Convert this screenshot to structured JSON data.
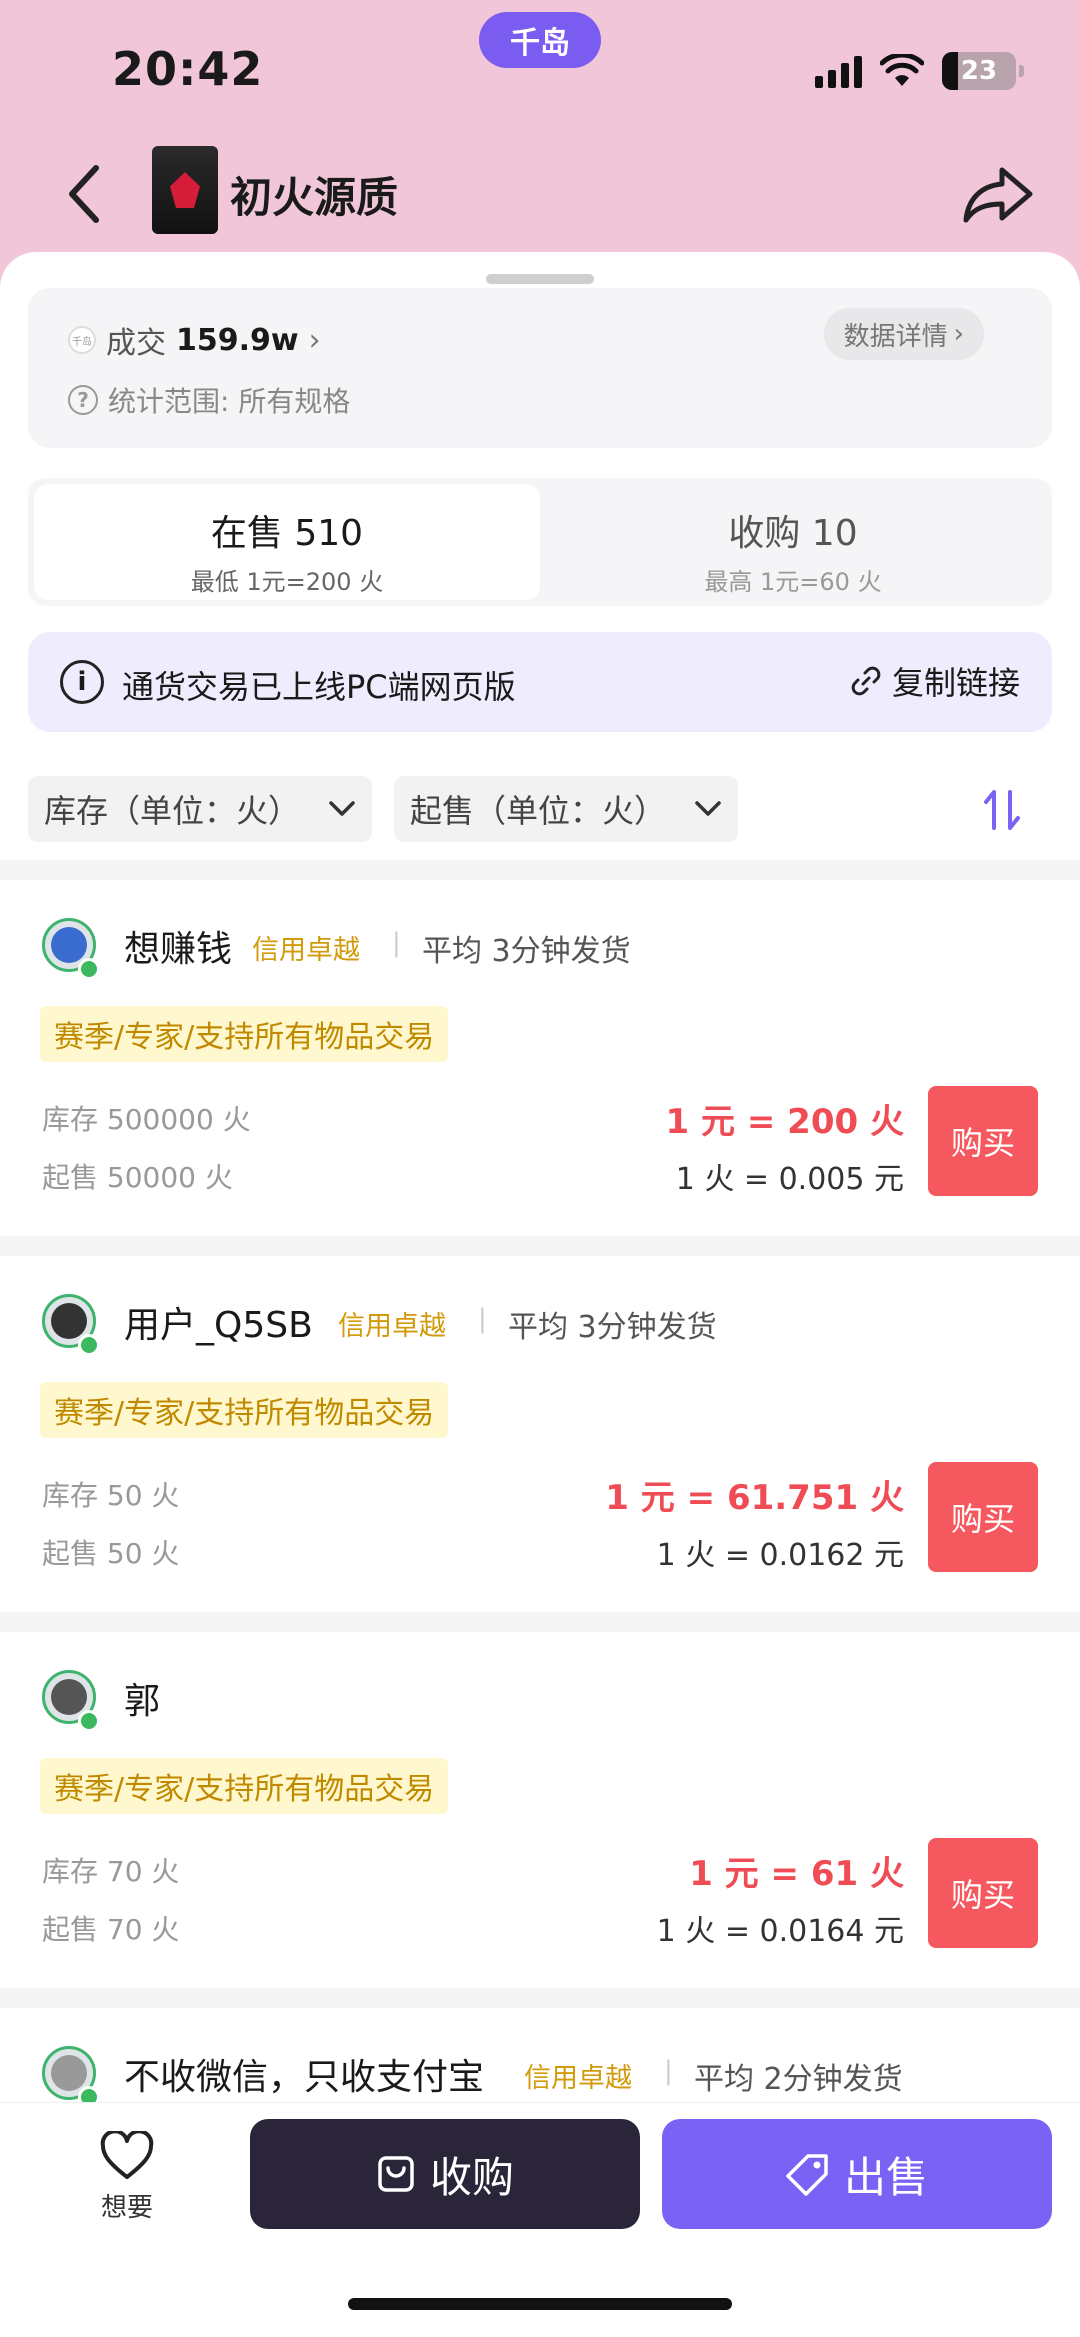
{
  "status_bar": {
    "time": "20:42",
    "app_pill": "千岛",
    "battery": "23"
  },
  "nav": {
    "title": "初火源质"
  },
  "stats": {
    "deal_label": "成交",
    "deal_value": "159.9w",
    "deal_chevron": "›",
    "detail_button": "数据详情",
    "detail_chevron": "›",
    "scope_text": "统计范围: 所有规格",
    "coin_mark": "千岛"
  },
  "tabs": [
    {
      "label": "在售 510",
      "sub": "最低 1元=200 火"
    },
    {
      "label": "收购 10",
      "sub": "最高 1元=60 火"
    }
  ],
  "notice": {
    "text": "通货交易已上线PC端网页版",
    "copy_link": "复制链接"
  },
  "filters": {
    "stock": "库存（单位：火）",
    "min_sale": "起售（单位：火）"
  },
  "listings": [
    {
      "name": "想赚钱",
      "credit": "信用卓越",
      "sep": "|",
      "avg": "平均 3分钟发货",
      "tag": "赛季/专家/支持所有物品交易",
      "stock": "库存 500000 火",
      "min": "起售 50000 火",
      "price": "1 元 = 200 火",
      "unit": "1 火 = 0.005 元",
      "buy": "购买"
    },
    {
      "name": "用户_Q5SB",
      "credit": "信用卓越",
      "sep": "|",
      "avg": "平均 3分钟发货",
      "tag": "赛季/专家/支持所有物品交易",
      "stock": "库存 50 火",
      "min": "起售 50 火",
      "price": "1 元 = 61.751 火",
      "unit": "1 火 = 0.0162 元",
      "buy": "购买"
    },
    {
      "name": "郭",
      "credit": "",
      "sep": "",
      "avg": "",
      "tag": "赛季/专家/支持所有物品交易",
      "stock": "库存 70 火",
      "min": "起售 70 火",
      "price": "1 元 = 61 火",
      "unit": "1 火 = 0.0164 元",
      "buy": "购买"
    },
    {
      "name": "不收微信，只收支付宝",
      "credit": "信用卓越",
      "sep": "|",
      "avg": "平均 2分钟发货"
    }
  ],
  "bottom": {
    "want": "想要",
    "buy": "收购",
    "sell": "出售"
  },
  "colors": {
    "accent": "#7a62f4",
    "price_red": "#ef4c55",
    "credit_gold": "#d29a0a",
    "online": "#3cb95e"
  },
  "icons": [
    "back-arrow-icon",
    "share-icon",
    "info-icon",
    "link-icon",
    "chevron-down-icon",
    "sort-icon",
    "heart-icon",
    "bag-icon",
    "tag-icon",
    "help-icon"
  ]
}
